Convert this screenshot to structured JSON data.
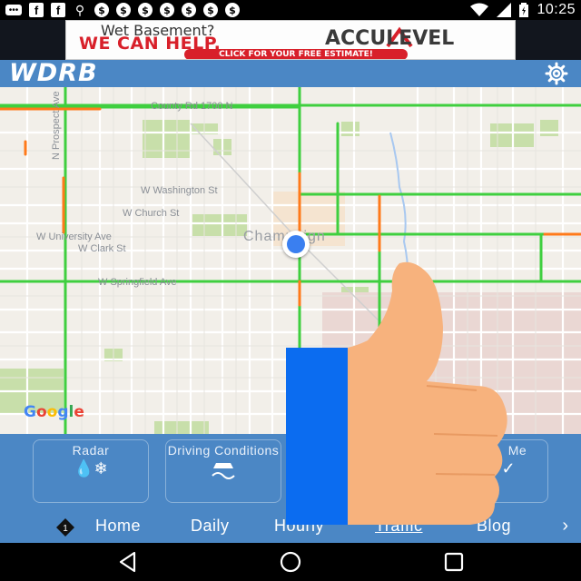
{
  "status_bar": {
    "time": "10:25",
    "icons": [
      "chat-icon",
      "facebook-icon",
      "facebook-icon",
      "pin-icon",
      "dollar-icon",
      "dollar-icon",
      "dollar-icon",
      "dollar-icon",
      "dollar-icon",
      "dollar-icon",
      "dollar-icon",
      "wifi-icon",
      "signal-icon",
      "battery-icon"
    ],
    "fb_glyph": "f",
    "dollar_glyph": "$"
  },
  "ad": {
    "line1": "Wet Basement?",
    "line2": "WE CAN HELP.",
    "brand": "ACCULEVEL",
    "cta": "CLICK FOR YOUR FREE ESTIMATE!"
  },
  "header": {
    "logo": "WDRB"
  },
  "map": {
    "labels": {
      "county_rd": "County Rd 1700 N",
      "prospect": "N Prospect Ave",
      "washington": "W Washington St",
      "church": "W Church St",
      "university": "W University Ave",
      "clark": "W Clark St",
      "springfield": "W Springfield Ave",
      "city": "Champaign"
    },
    "google_letters": [
      "G",
      "o",
      "o",
      "g",
      "l",
      "e"
    ],
    "colors": {
      "traffic_green": "#3fcf3f",
      "traffic_orange": "#ff7a1a",
      "park": "#c8dfaa",
      "road": "#ffffff"
    }
  },
  "tiles": {
    "radar": "Radar",
    "driving": "Driving Conditions",
    "partial": "Me"
  },
  "nav": {
    "badge_count": "1",
    "home": "Home",
    "daily": "Daily",
    "hourly": "Hourly",
    "traffic": "Traffic",
    "blog": "Blog",
    "next": "›"
  },
  "overlay": {
    "blue_bar": "#0b6cf0",
    "thumb_skin": "#f7b27d"
  }
}
